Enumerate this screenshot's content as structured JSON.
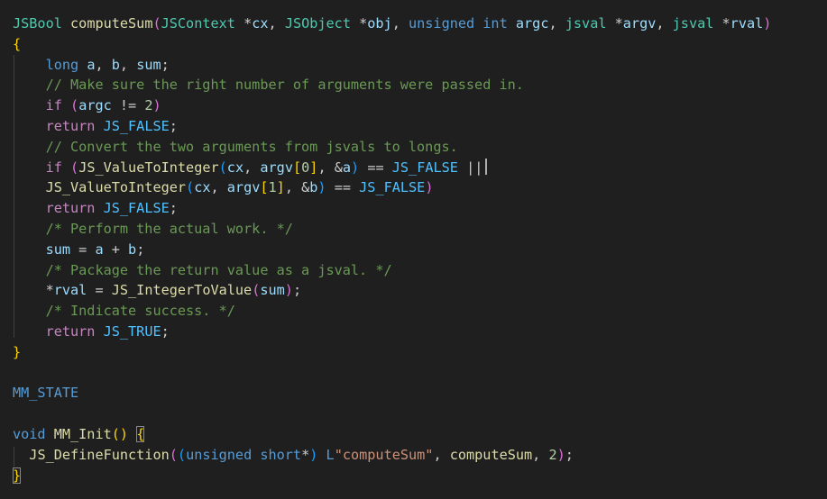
{
  "colors": {
    "background": "#1f1f1f",
    "plain": "#cccccc",
    "type": "#4ec9b0",
    "function": "#dcdcaa",
    "keyword": "#569cd6",
    "control": "#c586c0",
    "variable": "#9cdcfe",
    "constant": "#4fc1ff",
    "number": "#b5cea8",
    "string": "#ce9178",
    "comment": "#6a9955",
    "bracket1": "#ffd700",
    "bracket2": "#da70d6",
    "bracket3": "#179fff"
  },
  "code_lines": [
    [
      [
        "JSBool",
        "type"
      ],
      [
        " ",
        "plain"
      ],
      [
        "computeSum",
        "function"
      ],
      [
        "(",
        "bracket2"
      ],
      [
        "JSContext",
        "type"
      ],
      [
        " *",
        "plain"
      ],
      [
        "cx",
        "variable"
      ],
      [
        ", ",
        "plain"
      ],
      [
        "JSObject",
        "type"
      ],
      [
        " *",
        "plain"
      ],
      [
        "obj",
        "variable"
      ],
      [
        ", ",
        "plain"
      ],
      [
        "unsigned int",
        "keyword"
      ],
      [
        " ",
        "plain"
      ],
      [
        "argc",
        "variable"
      ],
      [
        ", ",
        "plain"
      ],
      [
        "jsval",
        "type"
      ],
      [
        " *",
        "plain"
      ],
      [
        "argv",
        "variable"
      ],
      [
        ", ",
        "plain"
      ],
      [
        "jsval",
        "type"
      ],
      [
        " *",
        "plain"
      ],
      [
        "rval",
        "variable"
      ],
      [
        ")",
        "bracket2"
      ]
    ],
    [
      [
        "{",
        "bracket1"
      ]
    ],
    [
      [
        "    ",
        "plain"
      ],
      [
        "long",
        "keyword"
      ],
      [
        " ",
        "plain"
      ],
      [
        "a",
        "variable"
      ],
      [
        ", ",
        "plain"
      ],
      [
        "b",
        "variable"
      ],
      [
        ", ",
        "plain"
      ],
      [
        "sum",
        "variable"
      ],
      [
        ";",
        "plain"
      ]
    ],
    [
      [
        "    ",
        "plain"
      ],
      [
        "// Make sure the right number of arguments were passed in.",
        "comment"
      ]
    ],
    [
      [
        "    ",
        "plain"
      ],
      [
        "if",
        "control"
      ],
      [
        " ",
        "plain"
      ],
      [
        "(",
        "bracket2"
      ],
      [
        "argc",
        "variable"
      ],
      [
        " != ",
        "plain"
      ],
      [
        "2",
        "number"
      ],
      [
        ")",
        "bracket2"
      ]
    ],
    [
      [
        "    ",
        "plain"
      ],
      [
        "return",
        "control"
      ],
      [
        " ",
        "plain"
      ],
      [
        "JS_FALSE",
        "constant"
      ],
      [
        ";",
        "plain"
      ]
    ],
    [
      [
        "    ",
        "plain"
      ],
      [
        "// Convert the two arguments from jsvals to longs.",
        "comment"
      ]
    ],
    [
      [
        "    ",
        "plain"
      ],
      [
        "if",
        "control"
      ],
      [
        " ",
        "plain"
      ],
      [
        "(",
        "bracket2"
      ],
      [
        "JS_ValueToInteger",
        "function"
      ],
      [
        "(",
        "bracket3"
      ],
      [
        "cx",
        "variable"
      ],
      [
        ", ",
        "plain"
      ],
      [
        "argv",
        "variable"
      ],
      [
        "[",
        "bracket1"
      ],
      [
        "0",
        "number"
      ],
      [
        "]",
        "bracket1"
      ],
      [
        ", &",
        "plain"
      ],
      [
        "a",
        "variable"
      ],
      [
        ")",
        "bracket3"
      ],
      [
        " == ",
        "plain"
      ],
      [
        "JS_FALSE",
        "constant"
      ],
      [
        " ||",
        "plain"
      ]
    ],
    [
      [
        "    ",
        "plain"
      ],
      [
        "JS_ValueToInteger",
        "function"
      ],
      [
        "(",
        "bracket3"
      ],
      [
        "cx",
        "variable"
      ],
      [
        ", ",
        "plain"
      ],
      [
        "argv",
        "variable"
      ],
      [
        "[",
        "bracket1"
      ],
      [
        "1",
        "number"
      ],
      [
        "]",
        "bracket1"
      ],
      [
        ", &",
        "plain"
      ],
      [
        "b",
        "variable"
      ],
      [
        ")",
        "bracket3"
      ],
      [
        " == ",
        "plain"
      ],
      [
        "JS_FALSE",
        "constant"
      ],
      [
        ")",
        "bracket2"
      ]
    ],
    [
      [
        "    ",
        "plain"
      ],
      [
        "return",
        "control"
      ],
      [
        " ",
        "plain"
      ],
      [
        "JS_FALSE",
        "constant"
      ],
      [
        ";",
        "plain"
      ]
    ],
    [
      [
        "    ",
        "plain"
      ],
      [
        "/* Perform the actual work. */",
        "comment"
      ]
    ],
    [
      [
        "    ",
        "plain"
      ],
      [
        "sum",
        "variable"
      ],
      [
        " = ",
        "plain"
      ],
      [
        "a",
        "variable"
      ],
      [
        " + ",
        "plain"
      ],
      [
        "b",
        "variable"
      ],
      [
        ";",
        "plain"
      ]
    ],
    [
      [
        "    ",
        "plain"
      ],
      [
        "/* Package the return value as a jsval. */",
        "comment"
      ]
    ],
    [
      [
        "    ",
        "plain"
      ],
      [
        "*",
        "plain"
      ],
      [
        "rval",
        "variable"
      ],
      [
        " = ",
        "plain"
      ],
      [
        "JS_IntegerToValue",
        "function"
      ],
      [
        "(",
        "bracket2"
      ],
      [
        "sum",
        "variable"
      ],
      [
        ")",
        "bracket2"
      ],
      [
        ";",
        "plain"
      ]
    ],
    [
      [
        "    ",
        "plain"
      ],
      [
        "/* Indicate success. */",
        "comment"
      ]
    ],
    [
      [
        "    ",
        "plain"
      ],
      [
        "return",
        "control"
      ],
      [
        " ",
        "plain"
      ],
      [
        "JS_TRUE",
        "constant"
      ],
      [
        ";",
        "plain"
      ]
    ],
    [
      [
        "}",
        "bracket1"
      ]
    ],
    [],
    [
      [
        "MM_STATE",
        "keyword"
      ]
    ],
    [],
    [
      [
        "void",
        "keyword"
      ],
      [
        " ",
        "plain"
      ],
      [
        "MM_Init",
        "function"
      ],
      [
        "()",
        "bracket1"
      ],
      [
        " ",
        "plain"
      ],
      [
        "{",
        "bracket1box"
      ]
    ],
    [
      [
        "  ",
        "plain"
      ],
      [
        "JS_DefineFunction",
        "function"
      ],
      [
        "(",
        "bracket2"
      ],
      [
        "(",
        "bracket3"
      ],
      [
        "unsigned short",
        "keyword"
      ],
      [
        "*",
        "plain"
      ],
      [
        ")",
        "bracket3"
      ],
      [
        " ",
        "plain"
      ],
      [
        "L",
        "keyword"
      ],
      [
        "\"computeSum\"",
        "string"
      ],
      [
        ", ",
        "plain"
      ],
      [
        "computeSum",
        "function"
      ],
      [
        ", ",
        "plain"
      ],
      [
        "2",
        "number"
      ],
      [
        ")",
        "bracket2"
      ],
      [
        ";",
        "plain"
      ]
    ],
    [
      [
        "}",
        "bracket1box"
      ]
    ]
  ]
}
